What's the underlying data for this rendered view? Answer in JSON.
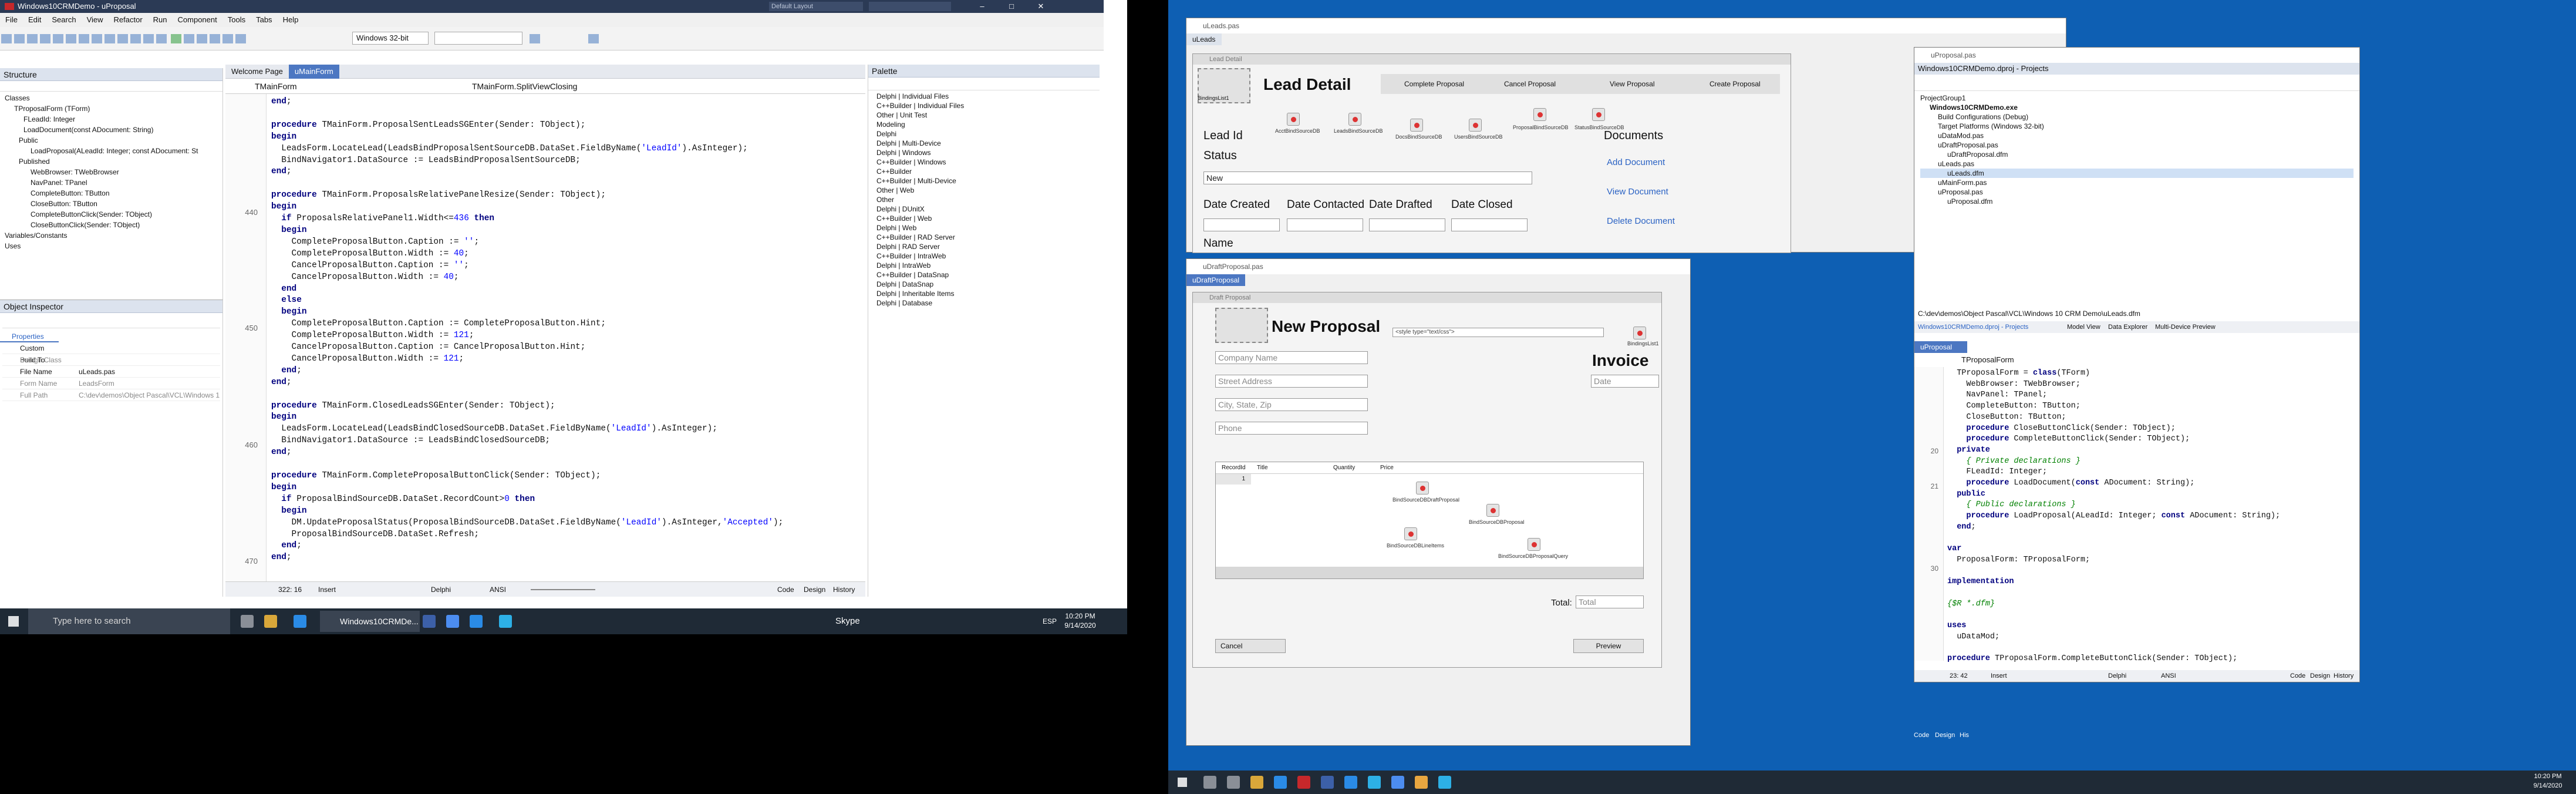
{
  "left": {
    "title": "Windows10CRMDemo - uProposal",
    "layout_select": "Default Layout",
    "menu": [
      "File",
      "Edit",
      "Search",
      "View",
      "Refactor",
      "Run",
      "Component",
      "Tools",
      "Tabs",
      "Help"
    ],
    "platform": "Windows 32-bit",
    "structure": {
      "title": "Structure",
      "rows": [
        "Classes",
        "TProposalForm (TForm)",
        "FLeadId: Integer",
        "LoadDocument(const ADocument: String)",
        "Public",
        "LoadProposal(ALeadId: Integer; const ADocument: St",
        "Published",
        "WebBrowser: TWebBrowser",
        "NavPanel: TPanel",
        "CompleteButton: TButton",
        "CloseButton: TButton",
        "CompleteButtonClick(Sender: TObject)",
        "CloseButtonClick(Sender: TObject)",
        "Variables/Constants",
        "Uses"
      ]
    },
    "object_inspector": {
      "title": "Object Inspector",
      "tab": "Properties",
      "rows": [
        [
          "Custom Build To",
          ""
        ],
        [
          "Design Class",
          ""
        ],
        [
          "File Name",
          "uLeads.pas"
        ],
        [
          "Form Name",
          "LeadsForm"
        ],
        [
          "Full Path",
          "C:\\dev\\demos\\Object Pascal\\VCL\\Windows 1"
        ]
      ]
    },
    "editor": {
      "tabs": [
        "Welcome Page",
        "uMainForm"
      ],
      "class_select": "TMainForm",
      "method_select": "TMainForm.SplitViewClosing",
      "line_numbers": [
        "440",
        "450",
        "460",
        "470"
      ],
      "status": {
        "pos": "322: 16",
        "mode": "Insert",
        "lang": "Delphi",
        "enc": "ANSI"
      },
      "bottom_tabs": [
        "Code",
        "Design",
        "History"
      ]
    },
    "palette": {
      "title": "Palette",
      "items": [
        "Delphi | Individual Files",
        "C++Builder | Individual Files",
        "Other | Unit Test",
        "Modeling",
        "Delphi",
        "Delphi | Multi-Device",
        "Delphi | Windows",
        "C++Builder | Windows",
        "C++Builder",
        "C++Builder | Multi-Device",
        "Other | Web",
        "Other",
        "Delphi | DUnitX",
        "C++Builder | Web",
        "Delphi | Web",
        "C++Builder | RAD Server",
        "Delphi | RAD Server",
        "C++Builder | IntraWeb",
        "Delphi | IntraWeb",
        "C++Builder | DataSnap",
        "Delphi | DataSnap",
        "Delphi | Inheritable Items",
        "Delphi | Database"
      ]
    },
    "taskbar": {
      "search": "Type here to search",
      "app": "Windows10CRMDe...",
      "skype": "Skype",
      "lang": "ESP",
      "time": "10:20 PM",
      "date": "9/14/2020"
    }
  },
  "right": {
    "leads_form": {
      "window_title": "uLeads.pas",
      "tab": "uLeads",
      "inner_title": "Lead Detail",
      "header": "Lead Detail",
      "image_label": "BindingsList1",
      "buttons": [
        "Complete Proposal",
        "Cancel Proposal",
        "View Proposal",
        "Create Proposal"
      ],
      "components": [
        "AcctBindSourceDB",
        "LeadsBindSourceDB",
        "DocsBindSourceDB",
        "UsersBindSourceDB",
        "ProposalBindSourceDB",
        "StatusBindSourceDB"
      ],
      "lead_id_label": "Lead Id",
      "status_label": "Status",
      "status_value": "New",
      "documents_label": "Documents",
      "links": [
        "Add Document",
        "View Document",
        "Delete Document"
      ],
      "date_labels": [
        "Date Created",
        "Date Contacted",
        "Date Drafted",
        "Date Closed"
      ],
      "name_label": "Name"
    },
    "proposal_form": {
      "window_title": "uDraftProposal.pas",
      "tab": "uDraftProposal",
      "inner_title": "Draft Proposal",
      "header": "New Proposal",
      "style_input": "<style type=\"text/css\">",
      "image_label": "BindingsList1",
      "invoice": "Invoice",
      "fields": [
        "Company Name",
        "Street Address",
        "City, State, Zip",
        "Phone"
      ],
      "date_placeholder": "Date",
      "grid_cols": [
        "RecordId",
        "Title",
        "Quantity",
        "Price"
      ],
      "grid_value": "1",
      "components": [
        "BindSourceDBDraftProposal",
        "BindSourceDBProposal",
        "BindSourceDBLineItems",
        "BindSourceDBProposalQuery"
      ],
      "total_label": "Total:",
      "total_placeholder": "Total",
      "cancel": "Cancel",
      "preview": "Preview"
    },
    "proj_window": {
      "window_title": "uProposal.pas",
      "projects_title": "Windows10CRMDemo.dproj - Projects",
      "tree": [
        "ProjectGroup1",
        "Windows10CRMDemo.exe",
        "Build Configurations (Debug)",
        "Target Platforms (Windows 32-bit)",
        "uDataMod.pas",
        "uDraftProposal.pas",
        "uDraftProposal.dfm",
        "uLeads.pas",
        "uLeads.dfm",
        "uMainForm.pas",
        "uProposal.pas",
        "uProposal.dfm"
      ],
      "path": "C:\\dev\\demos\\Object Pascal\\VCL\\Windows 10 CRM Demo\\uLeads.dfm",
      "tabs": [
        "Windows10CRMDemo.dproj - Projects",
        "Model View",
        "Data Explorer",
        "Multi-Device Preview"
      ],
      "editor_tab": "uProposal",
      "class_select": "TProposalForm",
      "line_numbers": [
        "20",
        "21",
        "30"
      ],
      "status": {
        "pos": "23: 42",
        "mode": "Insert",
        "lang": "Delphi",
        "enc": "ANSI"
      },
      "bottom_tabs": [
        "Code",
        "Design",
        "History"
      ]
    },
    "leads_bottom_tabs": [
      "Code",
      "Design",
      "His"
    ],
    "taskbar": {
      "time": "10:20 PM",
      "date": "9/14/2020"
    }
  }
}
